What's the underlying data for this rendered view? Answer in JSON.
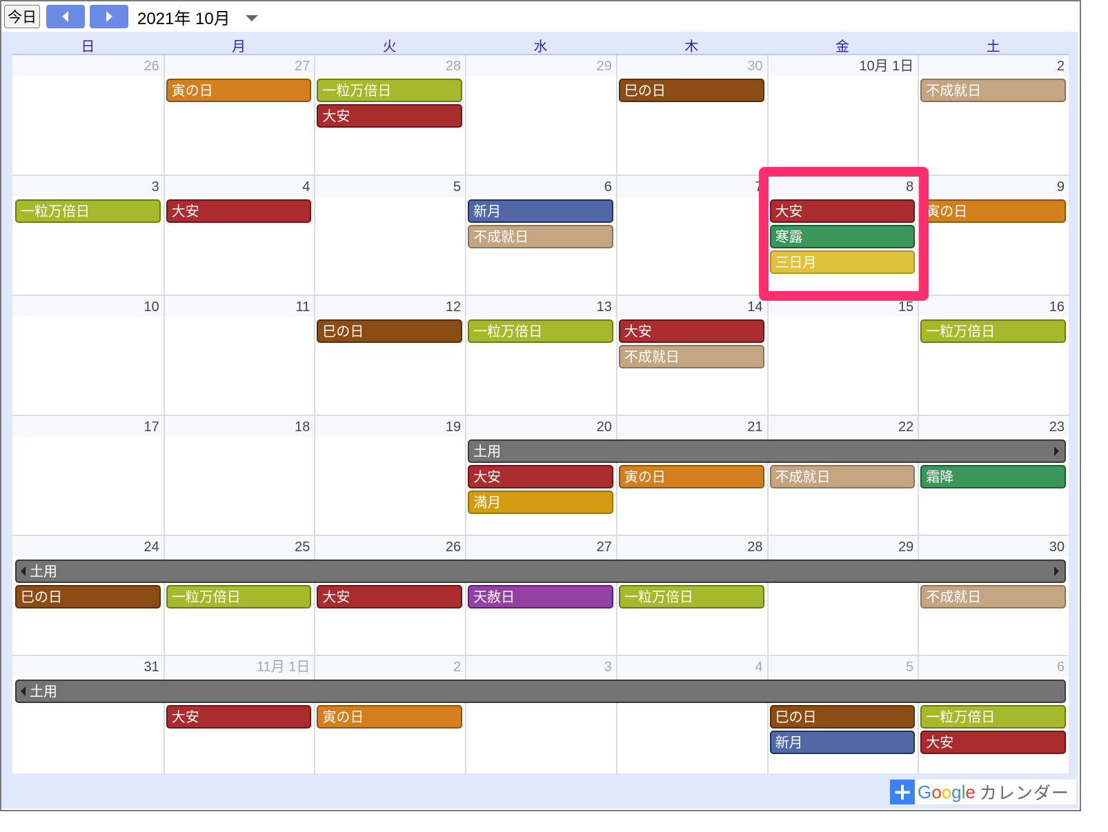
{
  "toolbar": {
    "today_label": "今日",
    "prev_icon": "chevron-left-icon",
    "next_icon": "chevron-right-icon",
    "month_title": "2021年 10月",
    "dropdown_icon": "caret-down-icon"
  },
  "weekdays": [
    "日",
    "月",
    "火",
    "水",
    "木",
    "金",
    "土"
  ],
  "colors": {
    "tora": {
      "bg": "#d47f1e",
      "border": "#8f5210"
    },
    "ichiryu": {
      "bg": "#a5b92a",
      "border": "#6b7a14"
    },
    "taian": {
      "bg": "#ab2c2e",
      "border": "#6e1416"
    },
    "mi": {
      "bg": "#8e4c15",
      "border": "#5a2e08"
    },
    "fujoju": {
      "bg": "#c4a582",
      "border": "#8f7352"
    },
    "shingetsu": {
      "bg": "#5068a6",
      "border": "#1f2f5e"
    },
    "sekki": {
      "bg": "#3a965a",
      "border": "#1a5e2e"
    },
    "mikazuki": {
      "bg": "#e0c23c",
      "border": "#b0921a"
    },
    "mangetsu": {
      "bg": "#d19c12",
      "border": "#9a720a"
    },
    "doyo": {
      "bg": "#737373",
      "border": "#3a3a3a"
    },
    "tensha": {
      "bg": "#9341a4",
      "border": "#5e1e6e"
    },
    "highlight": "#ff2e6f"
  },
  "weeks": [
    {
      "days": [
        {
          "label": "26",
          "other": true
        },
        {
          "label": "27",
          "other": true
        },
        {
          "label": "28",
          "other": true
        },
        {
          "label": "29",
          "other": true
        },
        {
          "label": "30",
          "other": true
        },
        {
          "label": "10月 1日",
          "other": false
        },
        {
          "label": "2",
          "other": false
        }
      ],
      "events": [
        {
          "title": "寅の日",
          "col": 1,
          "span": 1,
          "row": 0,
          "color": "tora"
        },
        {
          "title": "一粒万倍日",
          "col": 2,
          "span": 1,
          "row": 0,
          "color": "ichiryu"
        },
        {
          "title": "大安",
          "col": 2,
          "span": 1,
          "row": 1,
          "color": "taian"
        },
        {
          "title": "巳の日",
          "col": 4,
          "span": 1,
          "row": 0,
          "color": "mi"
        },
        {
          "title": "不成就日",
          "col": 6,
          "span": 1,
          "row": 0,
          "color": "fujoju"
        }
      ]
    },
    {
      "days": [
        {
          "label": "3"
        },
        {
          "label": "4"
        },
        {
          "label": "5"
        },
        {
          "label": "6"
        },
        {
          "label": "7"
        },
        {
          "label": "8"
        },
        {
          "label": "9"
        }
      ],
      "events": [
        {
          "title": "一粒万倍日",
          "col": 0,
          "span": 1,
          "row": 0,
          "color": "ichiryu"
        },
        {
          "title": "大安",
          "col": 1,
          "span": 1,
          "row": 0,
          "color": "taian"
        },
        {
          "title": "新月",
          "col": 3,
          "span": 1,
          "row": 0,
          "color": "shingetsu"
        },
        {
          "title": "不成就日",
          "col": 3,
          "span": 1,
          "row": 1,
          "color": "fujoju"
        },
        {
          "title": "大安",
          "col": 5,
          "span": 1,
          "row": 0,
          "color": "taian"
        },
        {
          "title": "寒露",
          "col": 5,
          "span": 1,
          "row": 1,
          "color": "sekki"
        },
        {
          "title": "三日月",
          "col": 5,
          "span": 1,
          "row": 2,
          "color": "mikazuki"
        },
        {
          "title": "寅の日",
          "col": 6,
          "span": 1,
          "row": 0,
          "color": "tora"
        }
      ]
    },
    {
      "days": [
        {
          "label": "10"
        },
        {
          "label": "11"
        },
        {
          "label": "12"
        },
        {
          "label": "13"
        },
        {
          "label": "14"
        },
        {
          "label": "15"
        },
        {
          "label": "16"
        }
      ],
      "events": [
        {
          "title": "巳の日",
          "col": 2,
          "span": 1,
          "row": 0,
          "color": "mi"
        },
        {
          "title": "一粒万倍日",
          "col": 3,
          "span": 1,
          "row": 0,
          "color": "ichiryu"
        },
        {
          "title": "大安",
          "col": 4,
          "span": 1,
          "row": 0,
          "color": "taian"
        },
        {
          "title": "不成就日",
          "col": 4,
          "span": 1,
          "row": 1,
          "color": "fujoju"
        },
        {
          "title": "一粒万倍日",
          "col": 6,
          "span": 1,
          "row": 0,
          "color": "ichiryu"
        }
      ]
    },
    {
      "days": [
        {
          "label": "17"
        },
        {
          "label": "18"
        },
        {
          "label": "19"
        },
        {
          "label": "20"
        },
        {
          "label": "21"
        },
        {
          "label": "22"
        },
        {
          "label": "23"
        }
      ],
      "events": [
        {
          "title": "土用",
          "col": 3,
          "span": 4,
          "row": 0,
          "color": "doyo",
          "cont_left": false,
          "cont_right": true
        },
        {
          "title": "大安",
          "col": 3,
          "span": 1,
          "row": 1,
          "color": "taian"
        },
        {
          "title": "寅の日",
          "col": 4,
          "span": 1,
          "row": 1,
          "color": "tora"
        },
        {
          "title": "不成就日",
          "col": 5,
          "span": 1,
          "row": 1,
          "color": "fujoju"
        },
        {
          "title": "霜降",
          "col": 6,
          "span": 1,
          "row": 1,
          "color": "sekki"
        },
        {
          "title": "満月",
          "col": 3,
          "span": 1,
          "row": 2,
          "color": "mangetsu"
        }
      ]
    },
    {
      "days": [
        {
          "label": "24"
        },
        {
          "label": "25"
        },
        {
          "label": "26"
        },
        {
          "label": "27"
        },
        {
          "label": "28"
        },
        {
          "label": "29"
        },
        {
          "label": "30"
        }
      ],
      "events": [
        {
          "title": "土用",
          "col": 0,
          "span": 7,
          "row": 0,
          "color": "doyo",
          "cont_left": true,
          "cont_right": true
        },
        {
          "title": "巳の日",
          "col": 0,
          "span": 1,
          "row": 1,
          "color": "mi"
        },
        {
          "title": "一粒万倍日",
          "col": 1,
          "span": 1,
          "row": 1,
          "color": "ichiryu"
        },
        {
          "title": "大安",
          "col": 2,
          "span": 1,
          "row": 1,
          "color": "taian"
        },
        {
          "title": "天赦日",
          "col": 3,
          "span": 1,
          "row": 1,
          "color": "tensha"
        },
        {
          "title": "一粒万倍日",
          "col": 4,
          "span": 1,
          "row": 1,
          "color": "ichiryu"
        },
        {
          "title": "不成就日",
          "col": 6,
          "span": 1,
          "row": 1,
          "color": "fujoju"
        }
      ]
    },
    {
      "days": [
        {
          "label": "31",
          "other": false
        },
        {
          "label": "11月 1日",
          "other": true
        },
        {
          "label": "2",
          "other": true
        },
        {
          "label": "3",
          "other": true
        },
        {
          "label": "4",
          "other": true
        },
        {
          "label": "5",
          "other": true
        },
        {
          "label": "6",
          "other": true
        }
      ],
      "events": [
        {
          "title": "土用",
          "col": 0,
          "span": 7,
          "row": 0,
          "color": "doyo",
          "cont_left": true,
          "cont_right": false
        },
        {
          "title": "大安",
          "col": 1,
          "span": 1,
          "row": 1,
          "color": "taian"
        },
        {
          "title": "寅の日",
          "col": 2,
          "span": 1,
          "row": 1,
          "color": "tora"
        },
        {
          "title": "巳の日",
          "col": 5,
          "span": 1,
          "row": 1,
          "color": "mi"
        },
        {
          "title": "新月",
          "col": 5,
          "span": 1,
          "row": 2,
          "color": "shingetsu"
        },
        {
          "title": "一粒万倍日",
          "col": 6,
          "span": 1,
          "row": 1,
          "color": "ichiryu"
        },
        {
          "title": "大安",
          "col": 6,
          "span": 1,
          "row": 2,
          "color": "taian"
        }
      ]
    }
  ],
  "footer": {
    "add_icon": "plus-icon",
    "google_text": "Google",
    "calendar_text": "カレンダー"
  }
}
